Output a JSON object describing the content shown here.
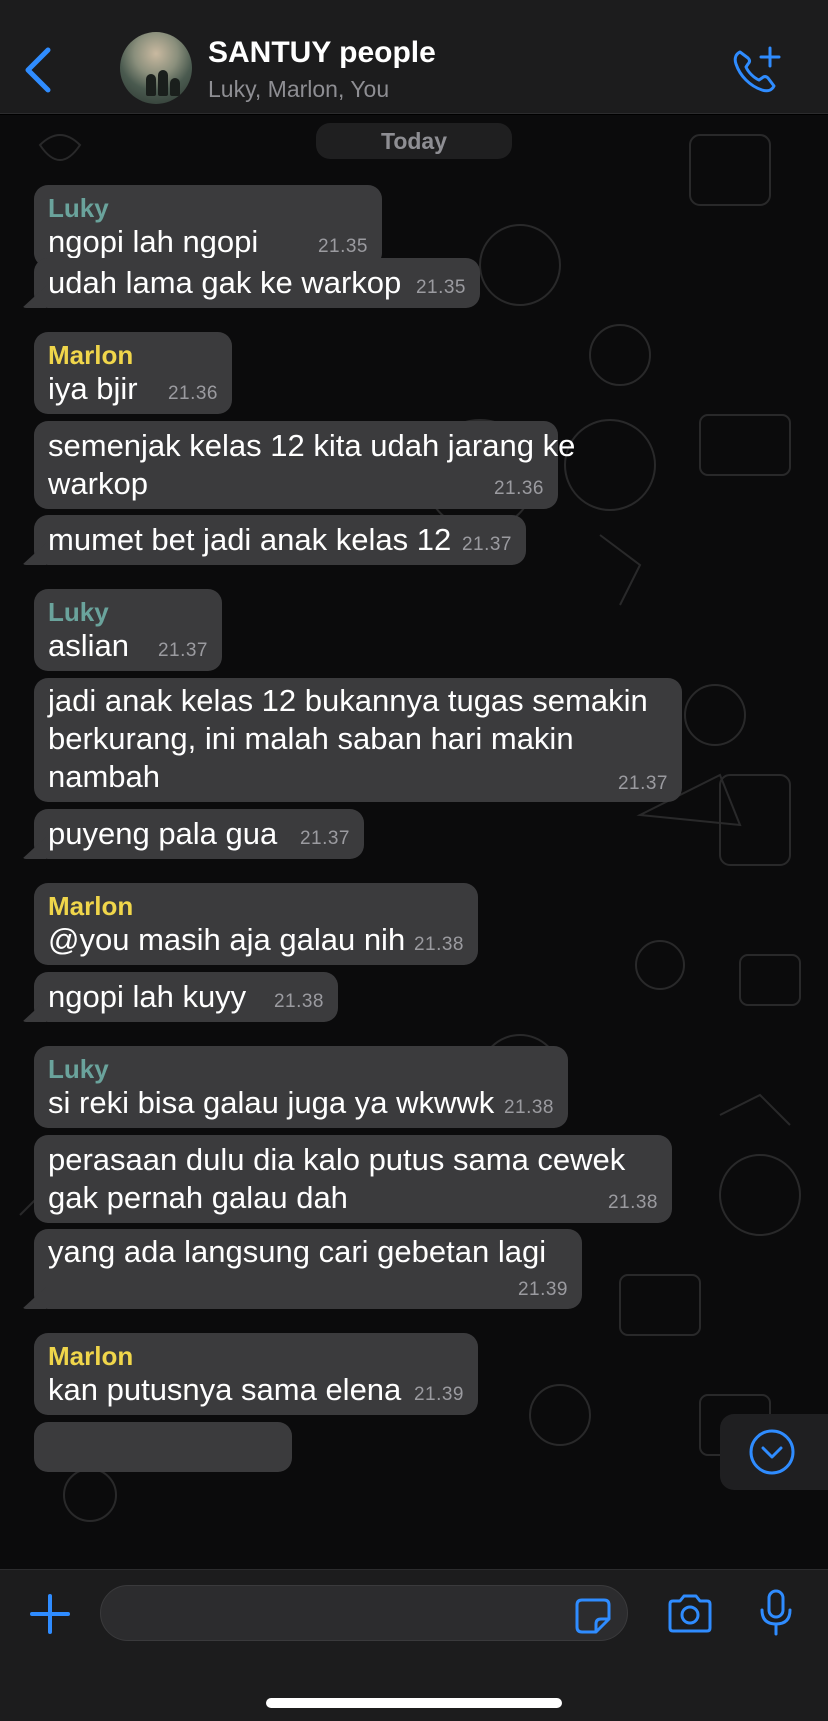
{
  "header": {
    "title": "SANTUY people",
    "members": "Luky, Marlon, You"
  },
  "chat": {
    "date_label": "Today",
    "messages": [
      {
        "sender": "Luky",
        "text": "ngopi lah ngopi",
        "time": "21.35"
      },
      {
        "text": "udah lama gak ke warkop",
        "time": "21.35"
      },
      {
        "sender": "Marlon",
        "text": "iya bjir",
        "time": "21.36"
      },
      {
        "text_lines": [
          "semenjak kelas 12 kita udah jarang ke",
          "warkop"
        ],
        "time": "21.36"
      },
      {
        "text": "mumet bet jadi anak kelas 12",
        "time": "21.37"
      },
      {
        "sender": "Luky",
        "text": "aslian",
        "time": "21.37"
      },
      {
        "text_lines": [
          "jadi anak kelas 12 bukannya tugas semakin",
          "berkurang, ini malah saban hari makin",
          "nambah"
        ],
        "time": "21.37"
      },
      {
        "text": "puyeng pala gua",
        "time": "21.37"
      },
      {
        "sender": "Marlon",
        "text": "@you masih aja galau nih",
        "time": "21.38"
      },
      {
        "text": "ngopi lah kuyy",
        "time": "21.38"
      },
      {
        "sender": "Luky",
        "text": "si reki bisa galau juga ya wkwwk",
        "time": "21.38"
      },
      {
        "text_lines": [
          "perasaan dulu dia kalo putus sama cewek",
          "gak pernah galau dah"
        ],
        "time": "21.38"
      },
      {
        "text": "yang ada langsung cari gebetan lagi",
        "time": "21.39"
      },
      {
        "sender": "Marlon",
        "text": "kan putusnya sama elena",
        "time": "21.39"
      }
    ]
  },
  "composer": {
    "placeholder": "",
    "value": ""
  },
  "icons": {
    "back": "chevron-left-icon",
    "call": "add-call-icon",
    "scroll": "chevron-down-circle-icon",
    "plus": "plus-icon",
    "sticker": "sticker-icon",
    "camera": "camera-icon",
    "mic": "microphone-icon"
  },
  "colors": {
    "accent": "#2f8cff",
    "luky": "#6aa39c",
    "marlon": "#f0d64b",
    "bubble": "#3b3b3d"
  }
}
